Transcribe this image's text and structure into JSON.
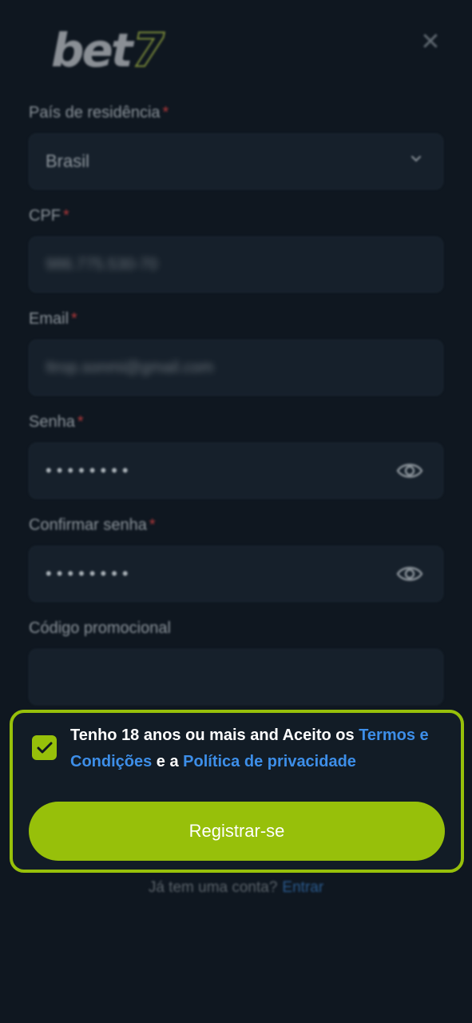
{
  "header": {
    "logo_main": "bet",
    "logo_seven": "7",
    "close_icon": "close-icon"
  },
  "form": {
    "country": {
      "label": "País de residência",
      "required_mark": "*",
      "value": "Brasil",
      "icon": "chevron-down-icon"
    },
    "cpf": {
      "label": "CPF",
      "required_mark": "*",
      "value": "986.775.530-70"
    },
    "email": {
      "label": "Email",
      "required_mark": "*",
      "value": "Itrop.sonmi@gmail.com"
    },
    "password": {
      "label": "Senha",
      "required_mark": "*",
      "value": "••••••••",
      "icon": "eye-icon"
    },
    "confirm_password": {
      "label": "Confirmar senha",
      "required_mark": "*",
      "value": "••••••••",
      "icon": "eye-icon"
    },
    "promo_code": {
      "label": "Código promocional",
      "value": ""
    }
  },
  "consent": {
    "checked": true,
    "text_before": "Tenho 18 anos ou mais and Aceito os ",
    "terms_link": "Termos e Condições",
    "text_middle": " e a ",
    "privacy_link": "Política de privacidade"
  },
  "register_button": {
    "label": "Registrar-se"
  },
  "login_prompt": {
    "text": "Já tem uma conta?",
    "link": "Entrar"
  },
  "colors": {
    "accent": "#97c00a",
    "link": "#3d8ee8",
    "background": "#0f1720",
    "required": "#b0383a"
  }
}
